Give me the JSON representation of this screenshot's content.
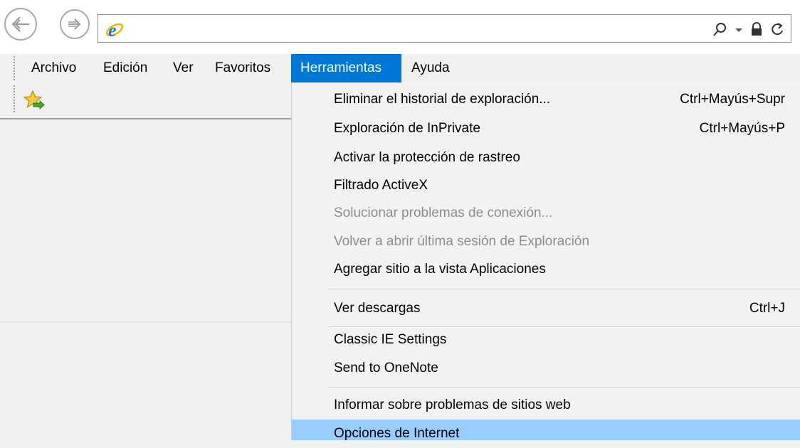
{
  "menubar": {
    "items": [
      {
        "label": "Archivo"
      },
      {
        "label": "Edición"
      },
      {
        "label": "Ver"
      },
      {
        "label": "Favoritos"
      },
      {
        "label": "Herramientas",
        "active": true
      },
      {
        "label": "Ayuda"
      }
    ]
  },
  "icons": {
    "back": "back-arrow-icon",
    "forward": "forward-arrow-icon",
    "site": "internet-explorer-logo-icon",
    "search": "search-icon",
    "dropdown": "chevron-down-icon",
    "lock": "lock-icon",
    "refresh": "refresh-icon",
    "favorites_add": "add-to-favorites-bar-icon"
  },
  "dropdown": {
    "items": [
      {
        "label": "Eliminar el historial de exploración...",
        "shortcut": "Ctrl+Mayús+Supr",
        "enabled": true
      },
      {
        "label": "Exploración de InPrivate",
        "shortcut": "Ctrl+Mayús+P",
        "enabled": true
      },
      {
        "label": "Activar la protección de rastreo",
        "shortcut": "",
        "enabled": true
      },
      {
        "label": "Filtrado ActiveX",
        "shortcut": "",
        "enabled": true
      },
      {
        "label": "Solucionar problemas de conexión...",
        "shortcut": "",
        "enabled": false
      },
      {
        "label": "Volver a abrir última sesión de Exploración",
        "shortcut": "",
        "enabled": false
      },
      {
        "label": "Agregar sitio a la vista Aplicaciones",
        "shortcut": "",
        "enabled": true
      },
      {
        "label": "Ver descargas",
        "shortcut": "Ctrl+J",
        "enabled": true
      },
      {
        "label": "Classic IE Settings",
        "shortcut": "",
        "enabled": true
      },
      {
        "label": "Send to OneNote",
        "shortcut": "",
        "enabled": true
      },
      {
        "label": "Informar sobre problemas de sitios web",
        "shortcut": "",
        "enabled": true
      },
      {
        "label": "Opciones de Internet",
        "shortcut": "",
        "enabled": true,
        "highlighted": true
      }
    ]
  },
  "colors": {
    "menu_active_bg": "#0078d7",
    "item_highlight_bg": "#99ccff",
    "disabled_text": "#8d8d8d"
  }
}
